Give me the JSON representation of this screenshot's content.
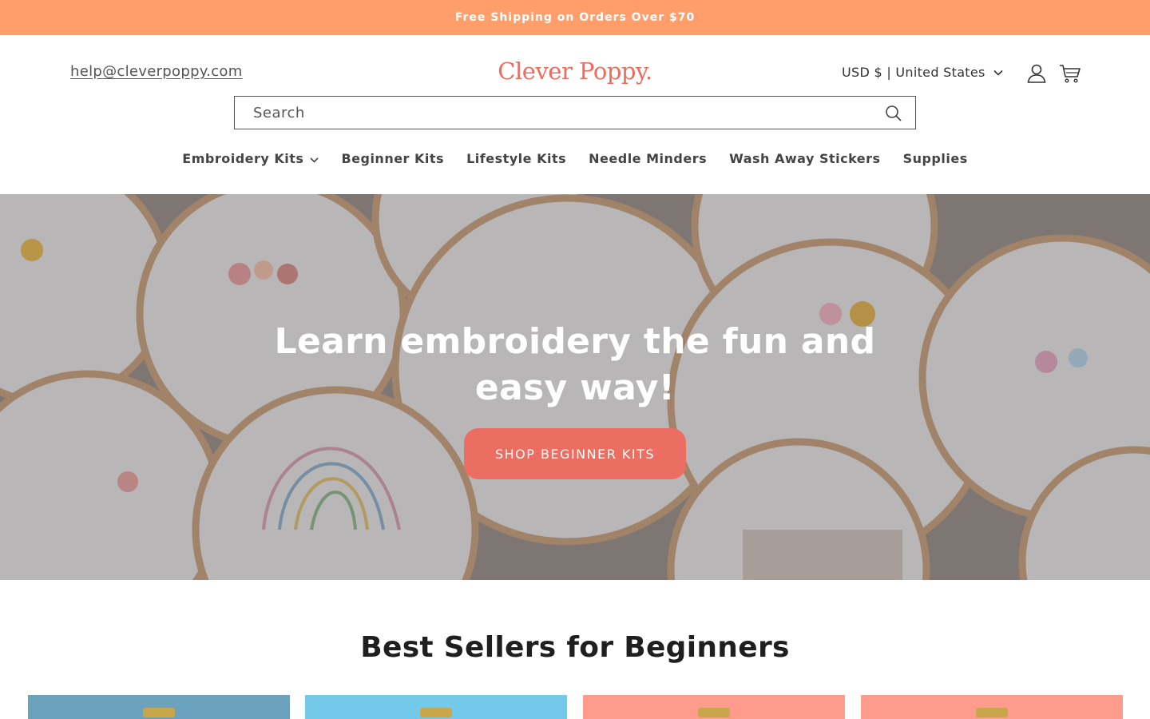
{
  "announcement": {
    "text": "Free Shipping on Orders Over $70"
  },
  "header": {
    "email": "help@cleverpoppy.com",
    "logo": "Clever Poppy.",
    "currency": "USD $ | United States",
    "icons": {
      "account": "account-icon",
      "cart": "cart-icon",
      "chevron": "chevron-down-icon"
    }
  },
  "search": {
    "placeholder": "Search",
    "value": "",
    "icon": "search-icon"
  },
  "nav": {
    "items": [
      {
        "label": "Embroidery Kits",
        "has_dropdown": true
      },
      {
        "label": "Beginner Kits"
      },
      {
        "label": "Lifestyle Kits"
      },
      {
        "label": "Needle Minders"
      },
      {
        "label": "Wash Away Stickers"
      },
      {
        "label": "Supplies"
      }
    ]
  },
  "hero": {
    "title": "Learn embroidery the fun and easy way!",
    "button": "SHOP BEGINNER KITS"
  },
  "best_sellers": {
    "title": "Best Sellers for Beginners",
    "card_colors": [
      "#6aa3bb",
      "#72c9ea",
      "#fd9c8d",
      "#fd9c8d"
    ]
  },
  "colors": {
    "announcement_bg": "#ff9e6b",
    "brand": "#ef6b5c",
    "button": "#ec6e62"
  }
}
